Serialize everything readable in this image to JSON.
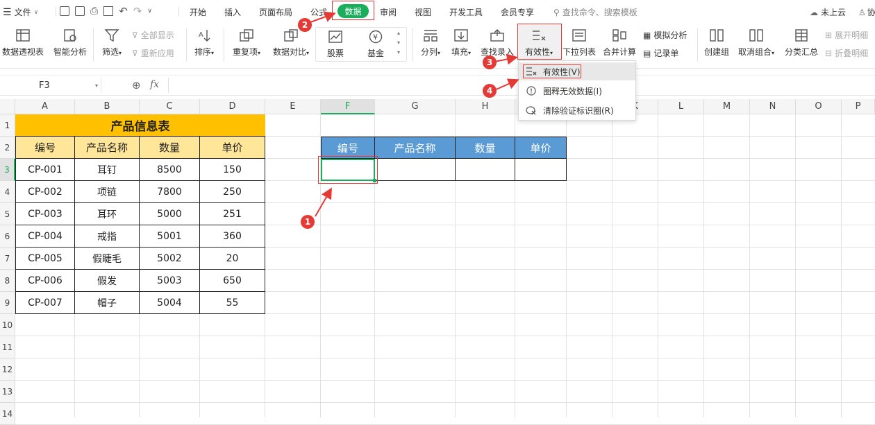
{
  "menubar": {
    "file_label": "文件",
    "tabs": [
      "开始",
      "插入",
      "页面布局",
      "公式",
      "数据",
      "审阅",
      "视图",
      "开发工具",
      "会员专享"
    ],
    "active_tab": "数据",
    "search_placeholder": "查找命令、搜索模板",
    "cloud_label": "未上云",
    "collab_label": "协"
  },
  "ribbon": {
    "pivot": "数据透视表",
    "smart": "智能分析",
    "filter": "筛选",
    "show_all": "全部显示",
    "reapply": "重新应用",
    "sort": "排序",
    "duplicate": "重复项",
    "compare": "数据对比",
    "stock": "股票",
    "fund": "基金",
    "split": "分列",
    "fill": "填充",
    "lookup": "查找录入",
    "validity": "有效性",
    "dropdown_list": "下拉列表",
    "merge_calc": "合并计算",
    "simulate": "模拟分析",
    "record": "记录单",
    "create_group": "创建组",
    "ungroup": "取消组合",
    "subtotal": "分类汇总",
    "expand": "展开明细",
    "collapse": "折叠明细"
  },
  "dropdown": {
    "items": [
      "有效性(V)",
      "圈释无效数据(I)",
      "清除验证标识圈(R)"
    ]
  },
  "formula_bar": {
    "name_box": "F3",
    "fx": "fx",
    "value": ""
  },
  "columns": [
    "A",
    "B",
    "C",
    "D",
    "E",
    "F",
    "G",
    "H",
    "I",
    "J",
    "K",
    "L",
    "M",
    "N",
    "O",
    "P"
  ],
  "rows": [
    "1",
    "2",
    "3",
    "4",
    "5",
    "6",
    "7",
    "8",
    "9",
    "10",
    "11",
    "12",
    "13",
    "14"
  ],
  "table1": {
    "title": "产品信息表",
    "headers": [
      "编号",
      "产品名称",
      "数量",
      "单价"
    ],
    "rows": [
      [
        "CP-001",
        "耳钉",
        "8500",
        "150"
      ],
      [
        "CP-002",
        "项链",
        "7800",
        "250"
      ],
      [
        "CP-003",
        "耳环",
        "5000",
        "251"
      ],
      [
        "CP-004",
        "戒指",
        "5001",
        "360"
      ],
      [
        "CP-005",
        "假睫毛",
        "5002",
        "20"
      ],
      [
        "CP-006",
        "假发",
        "5003",
        "650"
      ],
      [
        "CP-007",
        "帽子",
        "5004",
        "55"
      ]
    ]
  },
  "table2": {
    "headers": [
      "编号",
      "产品名称",
      "数量",
      "单价"
    ]
  },
  "steps": [
    "1",
    "2",
    "3",
    "4"
  ],
  "colors": {
    "accent_green": "#1aad5b",
    "title_fill": "#ffc000",
    "header_fill": "#ffe699",
    "table2_header": "#5b9bd5",
    "annotation_red": "#e53935"
  }
}
